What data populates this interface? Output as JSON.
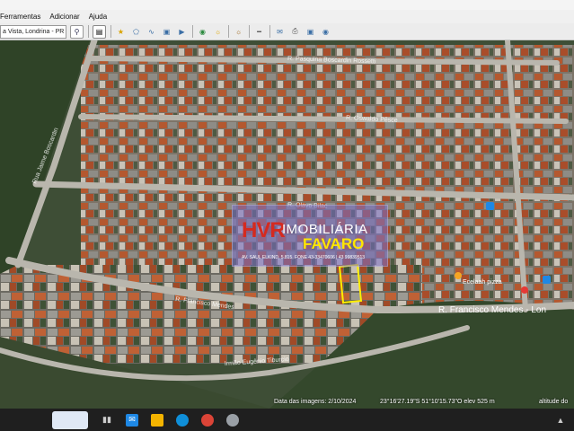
{
  "menu": {
    "items": [
      "Ferramentas",
      "Adicionar",
      "Ajuda"
    ]
  },
  "toolbar": {
    "location_value": "a Vista, Londrina - PR"
  },
  "map": {
    "streets": [
      "R. Pasquina Boscardin Rossetti",
      "R. Oswaldo Pêsce",
      "R. Olavo Bilac",
      "R. Francisco Mendes",
      "R. Francisco Mendes",
      "Rua Jaime Boscardin",
      "Irmão Eugênio Tiburcio"
    ],
    "poi": "Ecelaah pizza",
    "street_main": "R. Francisco Mendes - Lon"
  },
  "watermark": {
    "brand_line1": "IMOBILIÁRIA",
    "brand_line2": "FAVARO",
    "logo_text": "HVR",
    "contact": "AV. SAUL ELKIND, 5.815, FONE 43-33470606 | 43 99839513"
  },
  "status": {
    "imagery_date": "Data das imagens: 2/10/2024",
    "coords": "23°16'27.19\"S   51°10'15.73\"O  elev  525 m",
    "altitude": "altitude do"
  },
  "colors": {
    "accent": "#ffe600",
    "logo_red": "#d52a1f"
  }
}
